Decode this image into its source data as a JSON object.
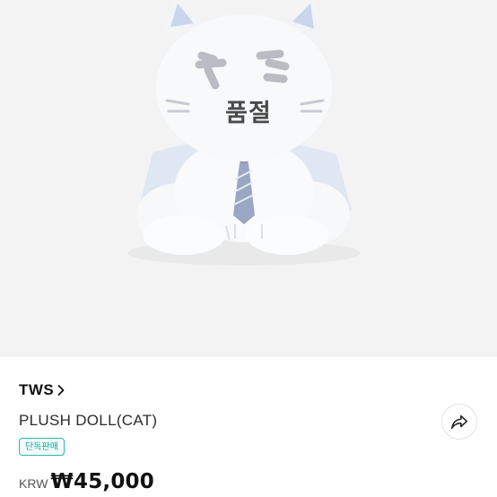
{
  "product_image": {
    "soldout_label": "품절"
  },
  "brand": {
    "name": "TWS",
    "chevron_icon": "chevron-right-icon"
  },
  "product": {
    "name": "PLUSH DOLL(CAT)",
    "badge": "단독판매",
    "currency_code": "KRW",
    "price": "₩45,000"
  },
  "share": {
    "icon": "share-icon"
  },
  "colors": {
    "badge_accent": "#16a59d",
    "hero_background": "#f3f3f3"
  }
}
